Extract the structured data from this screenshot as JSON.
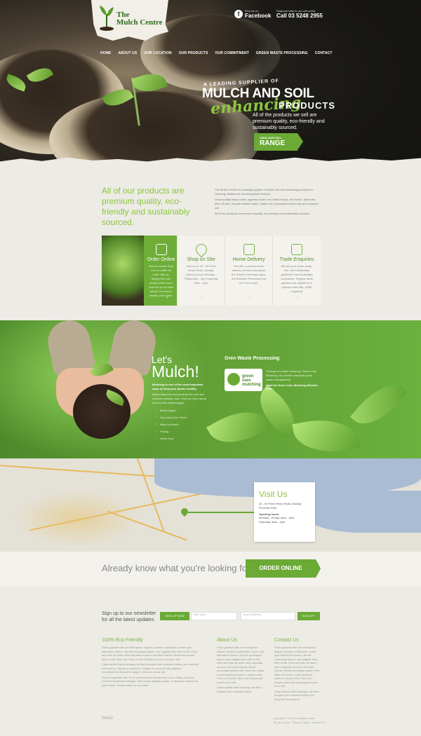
{
  "logo": {
    "line1": "The",
    "line2": "Mulch",
    "line3": "Centre"
  },
  "header": {
    "facebook_small": "Find us on",
    "facebook_label": "Facebook",
    "phone_small": "Regional calls to our call centre",
    "phone_label": "Call 03 5248 2955"
  },
  "nav": [
    "HOME",
    "ABOUT US",
    "OUR LOCATION",
    "OUR PRODUCTS",
    "OUR COMMITMENT",
    "GREEN WASTE PROCESSING",
    "CONTACT"
  ],
  "hero": {
    "kicker": "A LEADING SUPPLIER OF",
    "title": "MULCH AND SOIL",
    "script": "enhancing",
    "products": "PRODUCTS",
    "desc": "All of the products we sell are premium quality, eco-friendly and sustainably sourced.",
    "btn_small": "VIEW OUR FULL",
    "btn_big": "RANGE"
  },
  "intro": {
    "heading": "All of our products are premium quality, eco-friendly and sustainably sourced.",
    "p1": "The Mulch Centre is a leading supplier of mulch and soil enhancing products to Geelong, Melbourne and throughout Victoria.",
    "p2": "Great quality black mulch, cypress mulch, eco blend mulch, leaf mulch, pine bark, pine off cuts, recycled timber mulch, staple mix, composted wood chip and recycled soil.",
    "p3": "All of our products are premium quality eco-friendly and sustainably sourced."
  },
  "features": [
    {
      "title": "Order Online",
      "text": "How it's easier than ever to make an order with us. Simply fill in our simple online form and one of our staff will get in touch to finalise your order."
    },
    {
      "title": "Shop on Site",
      "text": "Visit us at: 42 - 50 Point Henry Road, Moolap. Opening hours Monday - Friday 8am - 4pm Saturday 8am - 1pm"
    },
    {
      "title": "Home Delivery",
      "text": "We offer a prompt home delivery service throughout the Greater Geelong region, the Bellarine Peninsula and the Surf Coast."
    },
    {
      "title": "Trade Enquiries",
      "text": "We are your home-away-line; from landscape gardeners and landscape companies. Regular trade partners are eligible for a special trade rate. (NBN required)"
    }
  ],
  "mulch": {
    "lets": "Let's",
    "title": "Mulch!",
    "desc_bold": "Mulching is one of the most important ways to keep your plants healthy.",
    "desc": "Mulch improves and protects the soil, and reduces moisture loss. Find out more about mulch in the below pages.",
    "links": [
      "Mulch Types",
      "How Much Do I Need",
      "When to Mulch",
      "Pricing",
      "Order Now"
    ]
  },
  "green": {
    "heading": "Gren Waste Processing",
    "logo_text1": "green",
    "logo_text2": "care",
    "logo_text3": "mulching",
    "desc": "Through our sister company, Green Care Mulching, we provide complete green waste management.",
    "link": "View the Green Care Mulching Website here ›"
  },
  "visit": {
    "title": "Visit Us",
    "address": "42 - 50 Point Henry Road, Moolap",
    "phone": "Ph 5248 2955",
    "hours_head": "Opening hours",
    "hours1": "Monday - Friday: 8am - 4pm",
    "hours2": "Saturday: 8am - 1pm"
  },
  "order": {
    "question": "Already know what you're looking for?",
    "btn": "ORDER ONLINE"
  },
  "newsletter": {
    "text1": "Sign up to our newsletter",
    "text2": "for all the latest updates.",
    "label": "SIGN UP NOW",
    "name_ph": "first name",
    "email_ph": "email address",
    "btn": "SIGN UP ›"
  },
  "footer": {
    "col1_h": "100% Eco Friendly",
    "col1_p1": "Proin gravida nibh vel velit auctor aliquet. Aenean sollicitudin, lorem quis bibendum auctor, nisi elit consequat ipsum, nec sagittis sem nibh id elit. Duis sed odio sit amet nibh vulputate cursus a sit amet mauris. Morbi accumsan ipsum velit. Nam nec tellus a odio tincidunt auctor a ornare odio.",
    "col1_p2": "Class aptent taciti sociosqu ad litora torquent per conubia nostra, per inceptos himenaeos. Mauris in erat justo. Nullam ac urna eu felis dapibus condimentum sit amet a augue. Sed non neque elit.",
    "col1_p3": "Sed ut imperdiet nisi. Proin condimentum fermentum nunc. Etiam pharetra, erat sed fermentum feugiat, velit mauris egestas quam, ut aliquam massa nisl quis neque. Suspendisse in orci enim.",
    "col2_h": "About Us",
    "col2_p1": "Proin gravida nibh vel velit auctor aliquet. Aenean sollicitudin, lorem quis bibendum auctor, nisi elit consequat ipsum, nec sagittis sem nibh id elit. Duis sed odio sit amet nibh vulputate cursus a sit amet mauris. Morbi accumsan ipsum velit. Nam nec tellus a odio tincidunt auctor a ornare odio. Sed non mauris vitae erat consequat auctor eu in elit.",
    "col2_p2": "Class aptent taciti sociosqu ad litora torquent per conubia nostra.",
    "col3_h": "Contact Us",
    "col3_p1": "Proin gravida nibh vel velit auctor aliquet. Aenean sollicitudin, lorem quis bibendum auctor, nisi elit consequat ipsum, nec sagittis sem nibh id elit. Duis sed odio sit amet nibh vulputate cursus a sit amet mauris. Morbi accumsan ipsum velit. Nam nec tellus a odio tincidunt auctor a ornare odio. Sed non mauris vitae erat consequat auctor eu in elit.",
    "col3_p2": "Class aptent taciti sociosqu ad litora torquent per conubia nostra, per inceptos himenaeos.",
    "logo": "Web3",
    "copy1": "copyright © 2013 Company name",
    "copy2": "Terms of Use · Privacy Policy · Contact Us"
  },
  "colors": {
    "accent": "#6aaa35",
    "accent_light": "#8dc63f",
    "bg": "#ecebe5"
  }
}
